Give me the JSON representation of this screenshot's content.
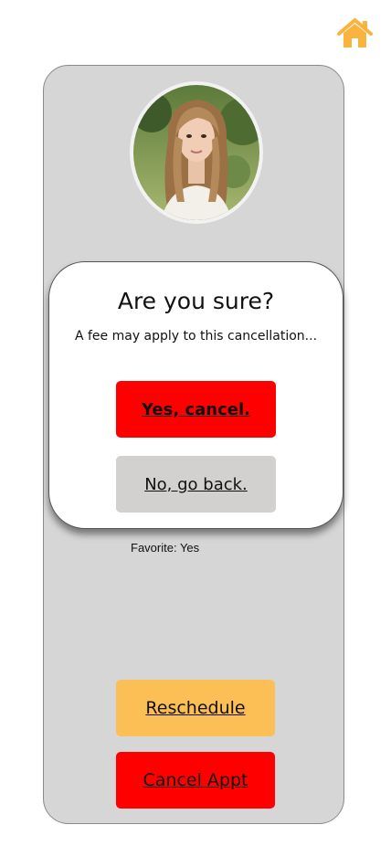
{
  "colors": {
    "home_icon": "#f9b440",
    "card_background": "#d6d6d6",
    "reschedule": "#fcbf55",
    "cancel": "#ff0000",
    "go_back": "#d3d0d0"
  },
  "header": {
    "home_icon": "home-icon"
  },
  "profile": {
    "avatar": "avatar",
    "favorite_text": "Favorite: Yes"
  },
  "actions": {
    "reschedule_label": "Reschedule",
    "cancel_label": "Cancel Appt"
  },
  "modal": {
    "title": "Are you sure?",
    "message": "A fee may apply to this cancellation...",
    "confirm_label": "Yes, cancel.",
    "back_label": "No, go back."
  }
}
